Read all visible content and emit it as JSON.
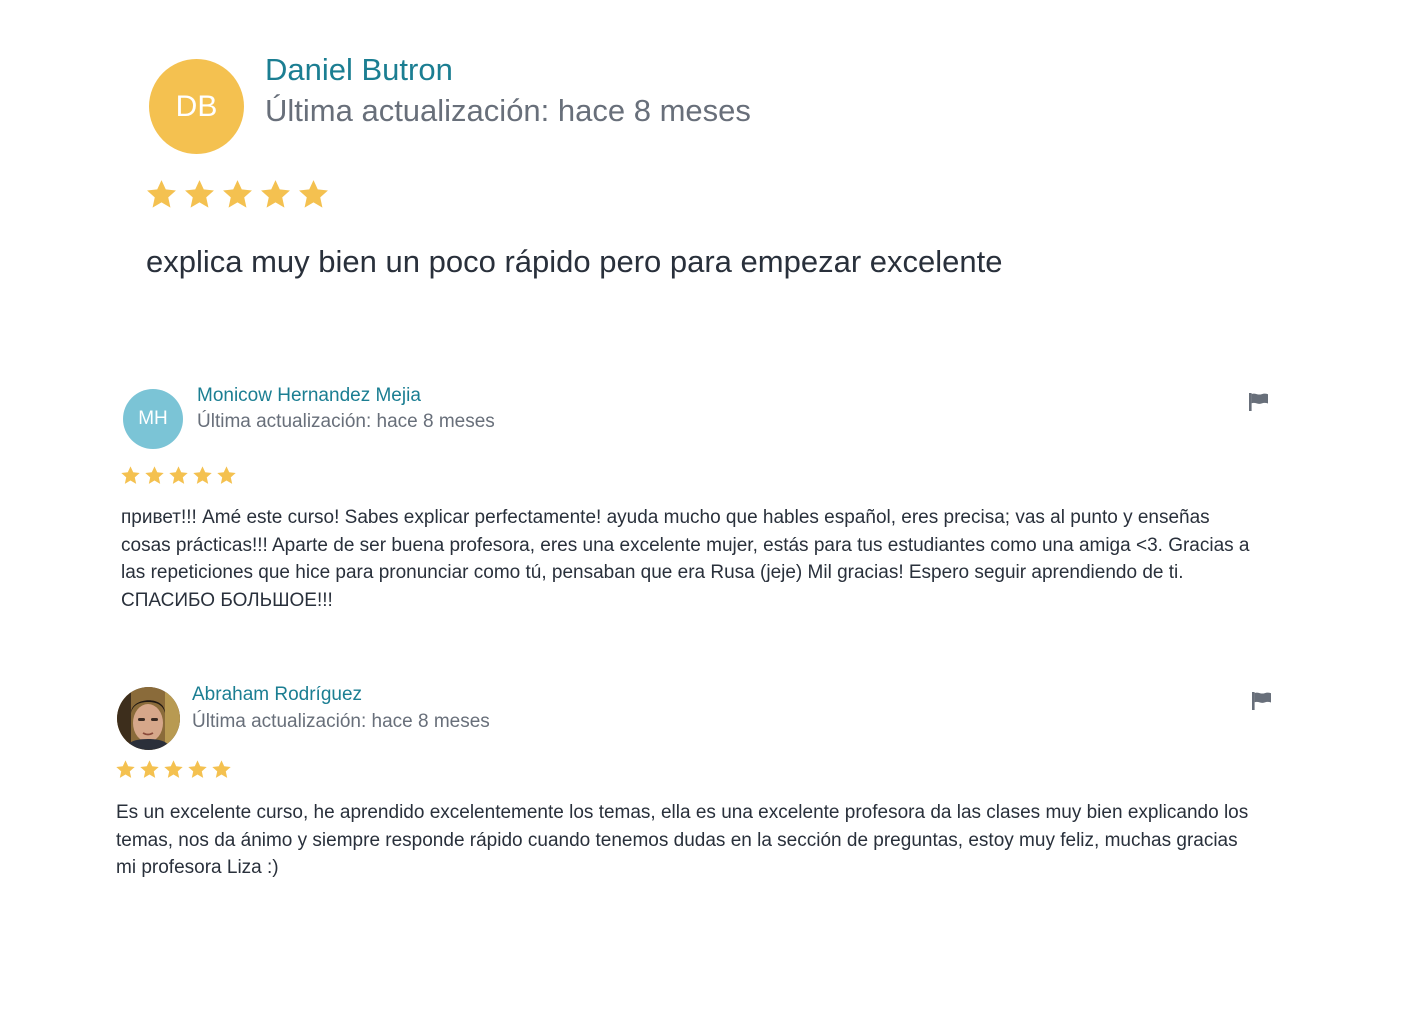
{
  "star_color": "#f4c150",
  "name_color": "#1b7e92",
  "meta_color": "#686f7a",
  "reviews": [
    {
      "initials": "DB",
      "avatar_color": "#f4c150",
      "name": "Daniel Butron",
      "updated": "Última actualización: hace 8 meses",
      "rating": 5,
      "text": "explica muy bien un poco rápido pero para empezar excelente"
    },
    {
      "initials": "MH",
      "avatar_color": "#7bc4d6",
      "name": "Monicow Hernandez Mejia",
      "updated": "Última actualización: hace 8 meses",
      "rating": 5,
      "text": "привет!!! Amé este curso! Sabes explicar perfectamente! ayuda mucho que hables español, eres precisa; vas al punto y enseñas cosas prácticas!!! Aparte de ser buena profesora, eres una excelente mujer, estás para tus estudiantes como una amiga <3. Gracias a las repeticiones que hice para pronunciar como tú, pensaban que era Rusa (jeje) Mil gracias! Espero seguir aprendiendo de ti. СПАСИБО БОЛЬШОЕ!!!",
      "flag_icon": "flag-icon"
    },
    {
      "avatar_icon": "user-photo",
      "name": "Abraham Rodríguez",
      "updated": "Última actualización: hace 8 meses",
      "rating": 5,
      "text": "Es un excelente curso, he aprendido excelentemente los temas, ella es una excelente profesora da las clases muy bien explicando los temas, nos da ánimo y siempre responde rápido cuando tenemos dudas en la sección de preguntas, estoy muy feliz, muchas gracias mi profesora Liza :)",
      "flag_icon": "flag-icon"
    }
  ]
}
